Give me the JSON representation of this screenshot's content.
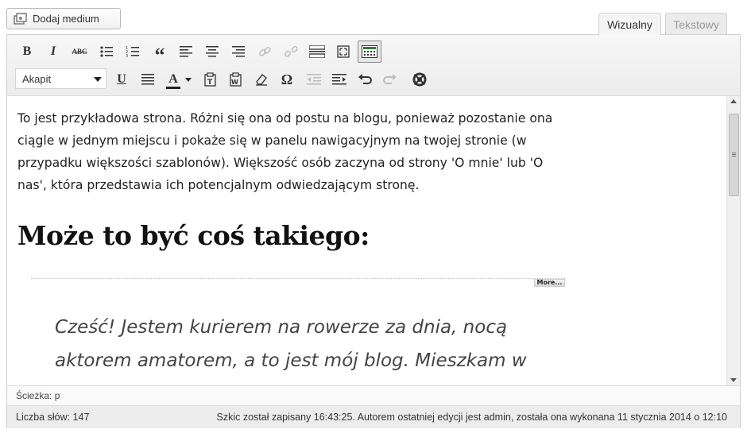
{
  "media": {
    "add_label": "Dodaj medium",
    "icon": "camera-music-icon"
  },
  "tabs": {
    "visual": "Wizualny",
    "text": "Tekstowy"
  },
  "toolbar": {
    "row1": [
      "bold-icon",
      "italic-icon",
      "strikethrough-icon",
      "bullet-list-icon",
      "numbered-list-icon",
      "blockquote-icon",
      "align-left-icon",
      "align-center-icon",
      "align-right-icon",
      "insert-link-icon",
      "unlink-icon",
      "insert-more-icon",
      "fullscreen-icon",
      "kitchen-sink-icon"
    ],
    "row2": [
      "underline-icon",
      "justify-icon",
      "text-color-icon",
      "paste-text-icon",
      "paste-word-icon",
      "clear-format-icon",
      "special-char-icon",
      "outdent-icon",
      "indent-icon",
      "undo-icon",
      "redo-icon",
      "help-icon"
    ],
    "format_value": "Akapit",
    "bold_glyph": "B",
    "italic_glyph": "I",
    "strike_glyph": "ABC",
    "quote_glyph": "“",
    "underline_glyph": "U",
    "color_glyph": "A",
    "omega_glyph": "Ω",
    "more_tag_label": "More..."
  },
  "content": {
    "paragraph": "To jest przykładowa strona. Różni się ona od postu na blogu, ponieważ pozostanie ona ciągle w jednym miejscu i pokaże się w panelu nawigacyjnym na twojej stronie (w przypadku większości szablonów). Większość osób zaczyna od strony 'O mnie' lub 'O nas', która przedstawia ich potencjalnym odwiedzającym stronę.",
    "heading": "Może to być coś takiego:",
    "quote": "Cześć! Jestem kurierem na rowerze za dnia, nocą aktorem amatorem, a to jest mój blog. Mieszkam w"
  },
  "path": {
    "label": "Ścieżka:",
    "value": "p"
  },
  "status": {
    "word_count": "Liczba słów: 147",
    "draft": "Szkic został zapisany 16:43:25. Autorem ostatniej edycji jest admin, została ona wykonana 11 stycznia 2014 o 12:10"
  },
  "colors": {
    "toolbar_bg": "#f0f0f0",
    "border": "#cfcfcf",
    "text": "#222222",
    "muted": "#999999"
  }
}
